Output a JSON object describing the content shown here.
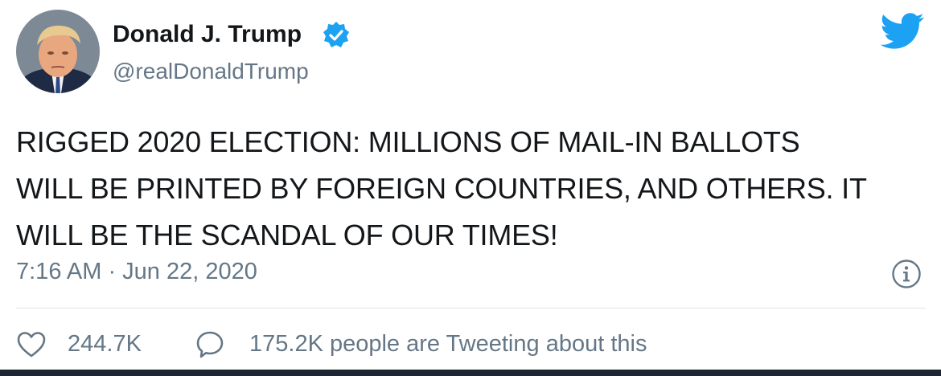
{
  "colors": {
    "brand": "#1da1f2",
    "text": "#14171a",
    "secondary": "#657786",
    "divider": "#dfe3e6"
  },
  "author": {
    "name": "Donald J. Trump",
    "handle": "@realDonaldTrump",
    "verified": true,
    "avatar_icon": "profile-photo",
    "verified_icon": "verified-badge-icon"
  },
  "header": {
    "brand_icon": "twitter-bird-icon"
  },
  "tweet": {
    "lines": [
      "RIGGED 2020 ELECTION: MILLIONS OF MAIL-IN BALLOTS",
      "WILL BE PRINTED BY FOREIGN COUNTRIES, AND OTHERS. IT",
      "WILL BE THE SCANDAL OF OUR TIMES!"
    ],
    "timestamp": "7:16 AM · Jun 22, 2020",
    "info_icon": "info-icon"
  },
  "footer": {
    "like_icon": "heart-icon",
    "like_count": "244.7K",
    "reply_icon": "speech-bubble-icon",
    "tweeting_text": "175.2K people are Tweeting about this"
  }
}
